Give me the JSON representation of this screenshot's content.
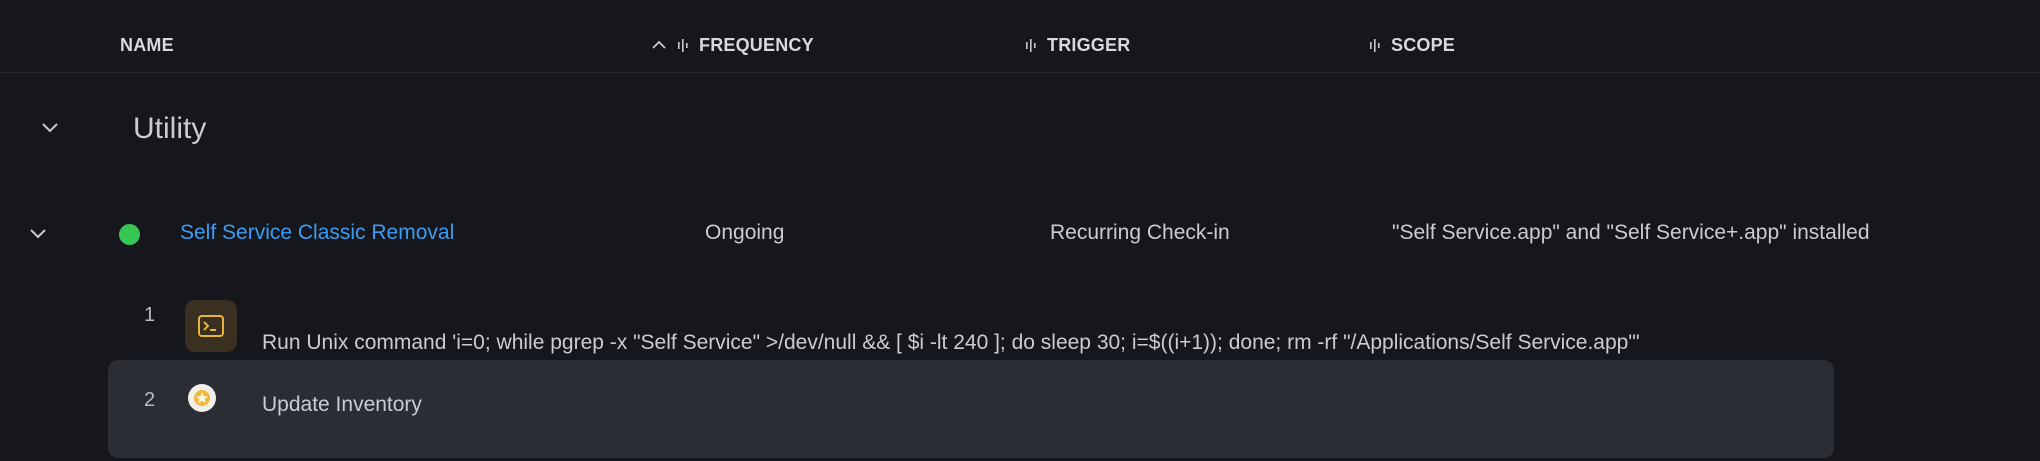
{
  "columns": {
    "name": "NAME",
    "frequency": "FREQUENCY",
    "trigger": "TRIGGER",
    "scope": "SCOPE"
  },
  "group": {
    "title": "Utility"
  },
  "policy": {
    "status": "enabled",
    "status_color": "#35c653",
    "name": "Self Service Classic Removal",
    "frequency": "Ongoing",
    "trigger": "Recurring Check-in",
    "scope": "\"Self Service.app\" and \"Self Service+.app\" installed"
  },
  "steps": [
    {
      "number": "1",
      "icon": "terminal-icon",
      "text": "Run Unix command 'i=0; while pgrep -x \"Self Service\" >/dev/null && [ $i -lt 240 ]; do sleep 30; i=$((i+1)); done; rm -rf \"/Applications/Self Service.app\"'"
    },
    {
      "number": "2",
      "icon": "inventory-icon",
      "text": "Update Inventory"
    }
  ],
  "colors": {
    "background": "#15171c",
    "link": "#3a9cf2",
    "highlight_row": "#2a2d33"
  }
}
